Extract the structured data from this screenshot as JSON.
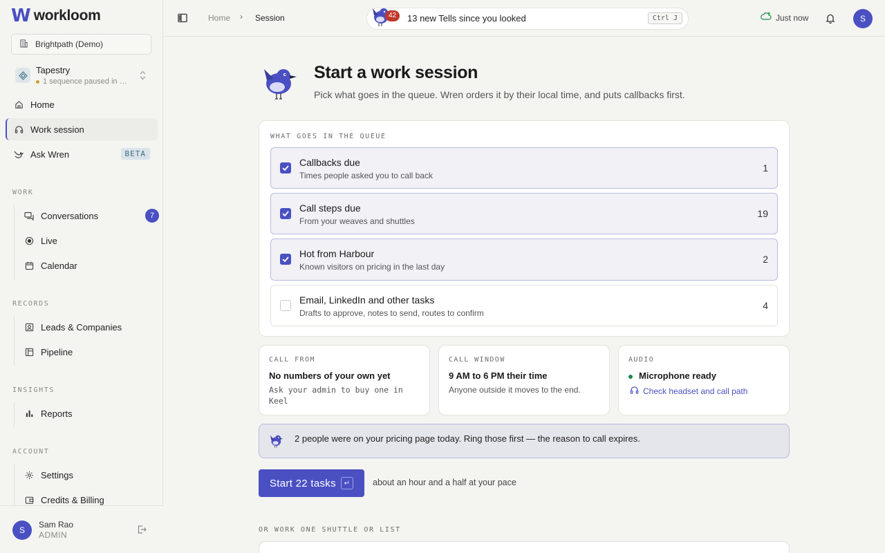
{
  "brand": {
    "name": "workloom",
    "mark": "W",
    "accent": "#4a50c2"
  },
  "org": {
    "name": "Brightpath (Demo)"
  },
  "workspace": {
    "name": "Tapestry",
    "status": "1 sequence paused in …"
  },
  "nav": {
    "home": "Home",
    "work_session": "Work session",
    "ask_wren": "Ask Wren",
    "beta": "BETA"
  },
  "sections": {
    "work": {
      "label": "WORK",
      "items": [
        {
          "label": "Conversations",
          "badge": "7"
        },
        {
          "label": "Live"
        },
        {
          "label": "Calendar"
        }
      ]
    },
    "records": {
      "label": "RECORDS",
      "items": [
        {
          "label": "Leads & Companies"
        },
        {
          "label": "Pipeline"
        }
      ]
    },
    "insights": {
      "label": "INSIGHTS",
      "items": [
        {
          "label": "Reports"
        }
      ]
    },
    "account": {
      "label": "ACCOUNT",
      "items": [
        {
          "label": "Settings"
        },
        {
          "label": "Credits & Billing"
        }
      ]
    }
  },
  "user": {
    "initial": "S",
    "name": "Sam Rao",
    "role": "ADMIN"
  },
  "topbar": {
    "breadcrumb": {
      "home": "Home",
      "sep": "›",
      "current": "Session"
    },
    "tells": {
      "badge": "42",
      "text": "13 new Tells since you looked",
      "shortcut": "Ctrl J"
    },
    "sync": "Just now",
    "avatar": "S"
  },
  "page": {
    "title": "Start a work session",
    "subtitle": "Pick what goes in the queue. Wren orders it by their local time, and puts callbacks first."
  },
  "queue": {
    "label": "WHAT GOES IN THE QUEUE",
    "items": [
      {
        "title": "Callbacks due",
        "desc": "Times people asked you to call back",
        "count": "1",
        "checked": true
      },
      {
        "title": "Call steps due",
        "desc": "From your weaves and shuttles",
        "count": "19",
        "checked": true
      },
      {
        "title": "Hot from Harbour",
        "desc": "Known visitors on pricing in the last day",
        "count": "2",
        "checked": true
      },
      {
        "title": "Email, LinkedIn and other tasks",
        "desc": "Drafts to approve, notes to send, routes to confirm",
        "count": "4",
        "checked": false
      }
    ]
  },
  "call_from": {
    "label": "CALL FROM",
    "title": "No numbers of your own yet",
    "desc": "Ask your admin to buy one in Keel"
  },
  "call_window": {
    "label": "CALL WINDOW",
    "title": "9 AM to 6 PM their time",
    "desc": "Anyone outside it moves to the end."
  },
  "audio": {
    "label": "AUDIO",
    "title": "Microphone ready",
    "link": "Check headset and call path"
  },
  "hint": {
    "text": "2 people were on your pricing page today. Ring those first — the reason to call expires."
  },
  "start": {
    "label": "Start 22 tasks",
    "key": "↵",
    "hint": "about an hour and a half at your pace"
  },
  "or_label": "OR WORK ONE SHUTTLE OR LIST"
}
